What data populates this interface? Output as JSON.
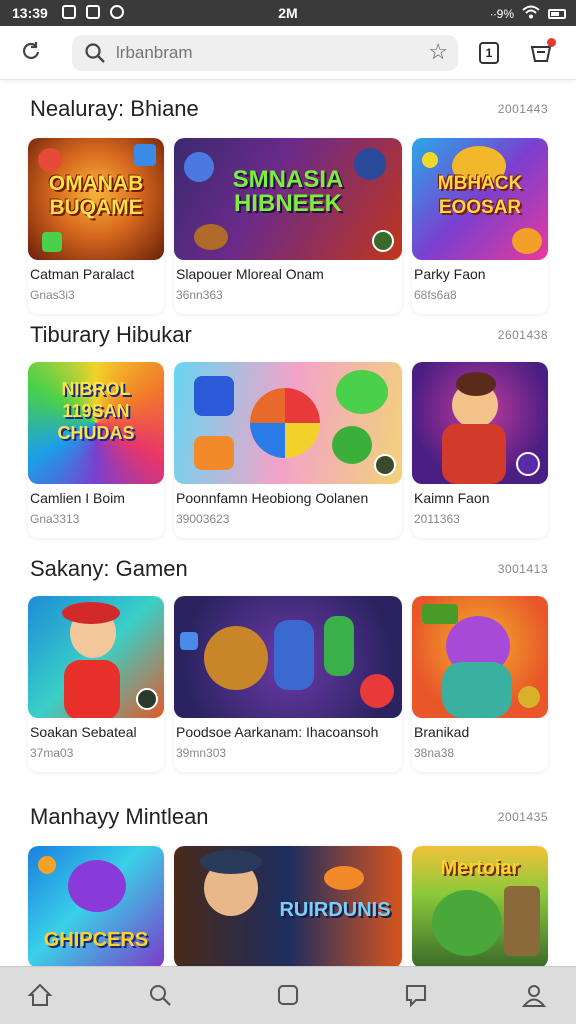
{
  "status_bar": {
    "time": "13:39",
    "center_text": "2M",
    "signal_text": "∙∙9%"
  },
  "toolbar": {
    "search_placeholder": "lrbanbram",
    "tab_count": "1"
  },
  "sections": [
    {
      "title": "Nealuray: Bhiane",
      "count": "2001443",
      "cards": [
        {
          "name": "Catman Paralact",
          "meta": "Gnas3i3",
          "logo": "OMANAB BUQAME",
          "bg": "#d7681e",
          "bg2": "#6a1f0a"
        },
        {
          "name": "Slapouer Mloreal Onam",
          "meta": "36nn363",
          "logo": "SMNASIA HIBNEEK",
          "bg": "#3a2a70",
          "bg2": "#c0361d"
        },
        {
          "name": "Parky Faon",
          "meta": "68fs6a8",
          "logo": "MBHACK EOOSAR",
          "bg": "#7a3fd0",
          "bg2": "#2aa8e8"
        }
      ]
    },
    {
      "title": "Tiburary Hibukar",
      "count": "2601438",
      "cards": [
        {
          "name": "Camlien I Boim",
          "meta": "Gna3313",
          "logo": "NIBROL 119SAN CHUDAS",
          "bg": "#1b9ee8",
          "bg2": "#e8356a"
        },
        {
          "name": "Poonnfamn Heobiong Oolanen",
          "meta": "39003623",
          "logo": "",
          "bg": "#f3a3c8",
          "bg2": "#66d6f2"
        },
        {
          "name": "Kaimn Faon",
          "meta": "2011363",
          "logo": "",
          "bg": "#4a1e82",
          "bg2": "#c23a9e"
        }
      ]
    },
    {
      "title": "Sakany: Gamen",
      "count": "3001413",
      "cards": [
        {
          "name": "Soakan Sebateal",
          "meta": "37ma03",
          "logo": "",
          "bg": "#1d8bd6",
          "bg2": "#e05a2a"
        },
        {
          "name": "Poodsoe Aarkanam: Ihacoansoh",
          "meta": "39mn303",
          "logo": "",
          "bg": "#2a2360",
          "bg2": "#6b3aa8"
        },
        {
          "name": "Branikad",
          "meta": "38na38",
          "logo": "",
          "bg": "#e8562a",
          "bg2": "#f2b22a"
        }
      ]
    },
    {
      "title": "Manhayy Mintlean",
      "count": "2001435",
      "cards": [
        {
          "name": "",
          "meta": "",
          "logo": "GHIPCERS",
          "bg": "#1a7fe0",
          "bg2": "#7b3ac8"
        },
        {
          "name": "",
          "meta": "",
          "logo": "RUIRDUNIS",
          "bg": "#1d2d5e",
          "bg2": "#d7561e"
        },
        {
          "name": "",
          "meta": "",
          "logo": "Mertoiar",
          "bg": "#5aa83a",
          "bg2": "#f0c23a"
        }
      ]
    }
  ]
}
